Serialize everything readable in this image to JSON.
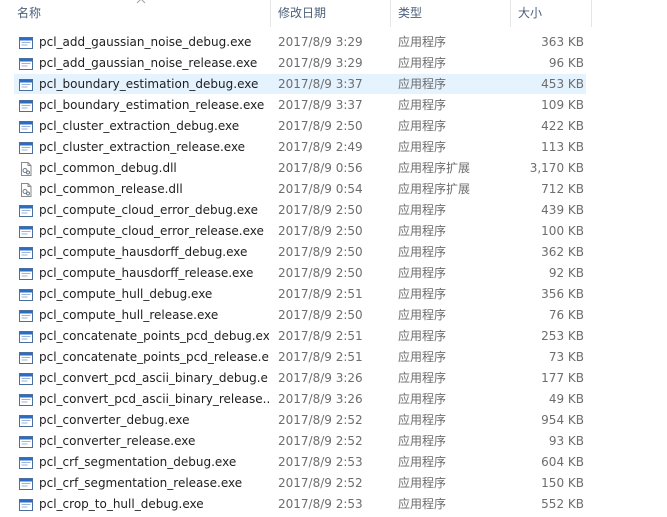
{
  "columns": {
    "name": "名称",
    "date": "修改日期",
    "type": "类型",
    "size": "大小"
  },
  "colors": {
    "header_text": "#4c607a",
    "selected_row": "#e5f3ff",
    "exe_icon_blue": "#2b6cc4"
  },
  "files": [
    {
      "name": "pcl_add_gaussian_noise_debug.exe",
      "date": "2017/8/9 3:29",
      "type": "应用程序",
      "size": "363 KB",
      "icon": "exe-icon"
    },
    {
      "name": "pcl_add_gaussian_noise_release.exe",
      "date": "2017/8/9 3:29",
      "type": "应用程序",
      "size": "96 KB",
      "icon": "exe-icon"
    },
    {
      "name": "pcl_boundary_estimation_debug.exe",
      "date": "2017/8/9 3:37",
      "type": "应用程序",
      "size": "453 KB",
      "icon": "exe-icon",
      "selected": true
    },
    {
      "name": "pcl_boundary_estimation_release.exe",
      "date": "2017/8/9 3:37",
      "type": "应用程序",
      "size": "109 KB",
      "icon": "exe-icon"
    },
    {
      "name": "pcl_cluster_extraction_debug.exe",
      "date": "2017/8/9 2:50",
      "type": "应用程序",
      "size": "422 KB",
      "icon": "exe-icon"
    },
    {
      "name": "pcl_cluster_extraction_release.exe",
      "date": "2017/8/9 2:49",
      "type": "应用程序",
      "size": "113 KB",
      "icon": "exe-icon"
    },
    {
      "name": "pcl_common_debug.dll",
      "date": "2017/8/9 0:56",
      "type": "应用程序扩展",
      "size": "3,170 KB",
      "icon": "dll-icon"
    },
    {
      "name": "pcl_common_release.dll",
      "date": "2017/8/9 0:54",
      "type": "应用程序扩展",
      "size": "712 KB",
      "icon": "dll-icon"
    },
    {
      "name": "pcl_compute_cloud_error_debug.exe",
      "date": "2017/8/9 2:50",
      "type": "应用程序",
      "size": "439 KB",
      "icon": "exe-icon"
    },
    {
      "name": "pcl_compute_cloud_error_release.exe",
      "date": "2017/8/9 2:50",
      "type": "应用程序",
      "size": "100 KB",
      "icon": "exe-icon"
    },
    {
      "name": "pcl_compute_hausdorff_debug.exe",
      "date": "2017/8/9 2:50",
      "type": "应用程序",
      "size": "362 KB",
      "icon": "exe-icon"
    },
    {
      "name": "pcl_compute_hausdorff_release.exe",
      "date": "2017/8/9 2:50",
      "type": "应用程序",
      "size": "92 KB",
      "icon": "exe-icon"
    },
    {
      "name": "pcl_compute_hull_debug.exe",
      "date": "2017/8/9 2:51",
      "type": "应用程序",
      "size": "356 KB",
      "icon": "exe-icon"
    },
    {
      "name": "pcl_compute_hull_release.exe",
      "date": "2017/8/9 2:50",
      "type": "应用程序",
      "size": "76 KB",
      "icon": "exe-icon"
    },
    {
      "name": "pcl_concatenate_points_pcd_debug.exe",
      "date": "2017/8/9 2:51",
      "type": "应用程序",
      "size": "253 KB",
      "icon": "exe-icon"
    },
    {
      "name": "pcl_concatenate_points_pcd_release.e...",
      "date": "2017/8/9 2:51",
      "type": "应用程序",
      "size": "73 KB",
      "icon": "exe-icon"
    },
    {
      "name": "pcl_convert_pcd_ascii_binary_debug.e...",
      "date": "2017/8/9 3:26",
      "type": "应用程序",
      "size": "177 KB",
      "icon": "exe-icon"
    },
    {
      "name": "pcl_convert_pcd_ascii_binary_release....",
      "date": "2017/8/9 3:26",
      "type": "应用程序",
      "size": "49 KB",
      "icon": "exe-icon"
    },
    {
      "name": "pcl_converter_debug.exe",
      "date": "2017/8/9 2:52",
      "type": "应用程序",
      "size": "954 KB",
      "icon": "exe-icon"
    },
    {
      "name": "pcl_converter_release.exe",
      "date": "2017/8/9 2:52",
      "type": "应用程序",
      "size": "93 KB",
      "icon": "exe-icon"
    },
    {
      "name": "pcl_crf_segmentation_debug.exe",
      "date": "2017/8/9 2:53",
      "type": "应用程序",
      "size": "604 KB",
      "icon": "exe-icon"
    },
    {
      "name": "pcl_crf_segmentation_release.exe",
      "date": "2017/8/9 2:52",
      "type": "应用程序",
      "size": "150 KB",
      "icon": "exe-icon"
    },
    {
      "name": "pcl_crop_to_hull_debug.exe",
      "date": "2017/8/9 2:53",
      "type": "应用程序",
      "size": "552 KB",
      "icon": "exe-icon"
    }
  ]
}
